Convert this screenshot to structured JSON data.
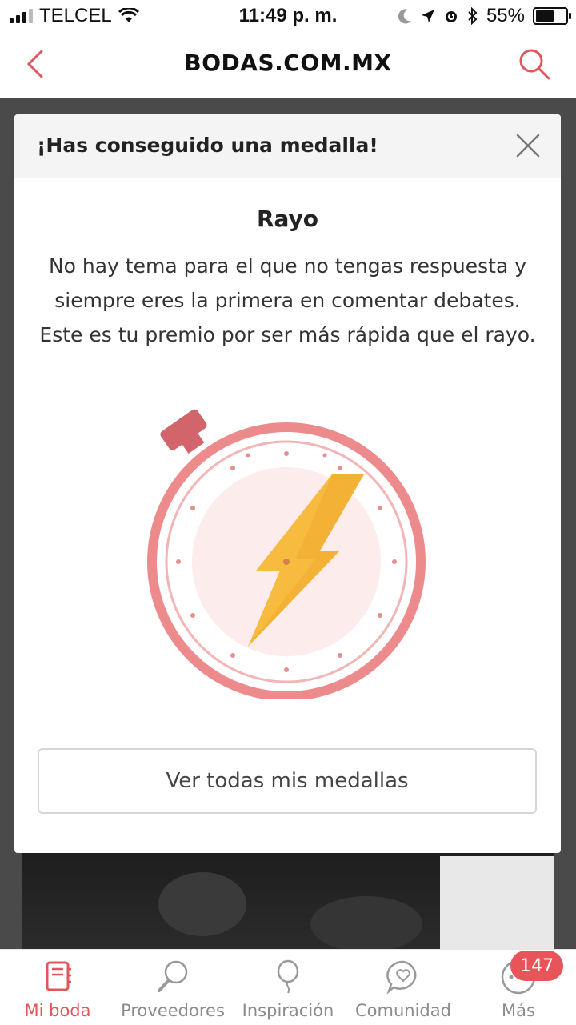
{
  "status_bar": {
    "carrier": "TELCEL",
    "time": "11:49 p. m.",
    "battery": "55%"
  },
  "nav": {
    "title": "BODAS.COM.MX"
  },
  "modal": {
    "title": "¡Has conseguido una medalla!",
    "medal_name": "Rayo",
    "description": "No hay tema para el que no tengas respuesta y siempre eres la primera en comentar debates. Este es tu premio por ser más rápida que el rayo.",
    "button_label": "Ver todas mis medallas"
  },
  "tabbar": {
    "items": [
      {
        "label": "Mi boda",
        "icon": "wedding-planner-icon",
        "active": true
      },
      {
        "label": "Proveedores",
        "icon": "search-magnifier-icon",
        "active": false
      },
      {
        "label": "Inspiración",
        "icon": "balloon-icon",
        "active": false
      },
      {
        "label": "Comunidad",
        "icon": "chat-heart-icon",
        "active": false
      },
      {
        "label": "Más",
        "icon": "more-dots-icon",
        "active": false
      }
    ],
    "more_badge": "147"
  },
  "colors": {
    "accent": "#e0575b",
    "medal_ring": "#ec8a8c",
    "bolt": "#f6bb3f"
  }
}
